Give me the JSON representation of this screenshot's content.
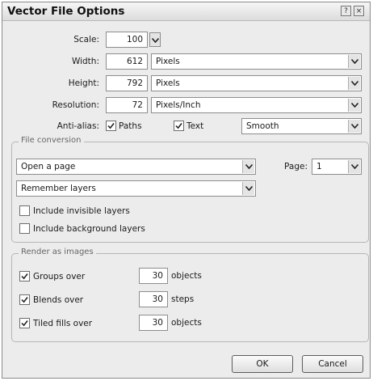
{
  "dialog": {
    "title": "Vector File Options"
  },
  "titlebar": {
    "help_glyph": "?",
    "close_glyph": "×"
  },
  "scale": {
    "label": "Scale:",
    "value": "100"
  },
  "width": {
    "label": "Width:",
    "value": "612",
    "unit": "Pixels"
  },
  "height": {
    "label": "Height:",
    "value": "792",
    "unit": "Pixels"
  },
  "resolution": {
    "label": "Resolution:",
    "value": "72",
    "unit": "Pixels/Inch"
  },
  "antialias": {
    "label": "Anti-alias:",
    "paths_label": "Paths",
    "paths_checked": true,
    "text_label": "Text",
    "text_checked": true,
    "mode": "Smooth"
  },
  "file_conversion": {
    "title": "File conversion",
    "page_mode": "Open a page",
    "page_label": "Page:",
    "page_value": "1",
    "layers_mode": "Remember layers",
    "invisible_label": "Include invisible layers",
    "invisible_checked": false,
    "background_label": "Include background layers",
    "background_checked": false
  },
  "render_images": {
    "title": "Render as images",
    "groups_label": "Groups over",
    "groups_checked": true,
    "groups_value": "30",
    "groups_unit": "objects",
    "blends_label": "Blends over",
    "blends_checked": true,
    "blends_value": "30",
    "blends_unit": "steps",
    "tiled_label": "Tiled fills over",
    "tiled_checked": true,
    "tiled_value": "30",
    "tiled_unit": "objects"
  },
  "buttons": {
    "ok": "OK",
    "cancel": "Cancel"
  }
}
